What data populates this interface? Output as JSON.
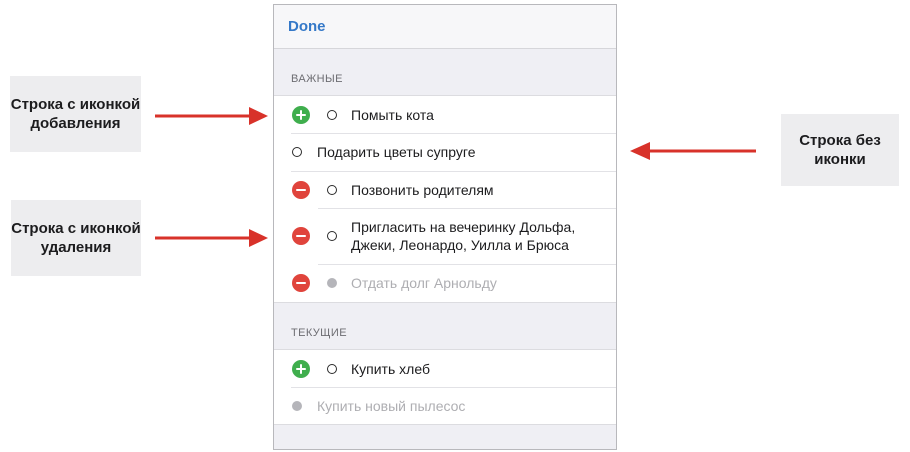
{
  "nav": {
    "done_label": "Done"
  },
  "sections": [
    {
      "header": "ВАЖНЫЕ",
      "rows": [
        {
          "control": "add",
          "status": "open",
          "text": "Помыть кота"
        },
        {
          "control": "none",
          "status": "open",
          "text": "Подарить цветы супруге"
        },
        {
          "control": "remove",
          "status": "open",
          "text": "Позвонить родителям"
        },
        {
          "control": "remove",
          "status": "open",
          "text": "Пригласить на вечеринку Дольфа, Джеки, Леонардо, Уилла и Брюса"
        },
        {
          "control": "remove",
          "status": "done",
          "text": "Отдать долг Арнольду"
        }
      ]
    },
    {
      "header": "ТЕКУЩИЕ",
      "rows": [
        {
          "control": "add",
          "status": "open",
          "text": "Купить хлеб"
        },
        {
          "control": "none",
          "status": "done",
          "text": "Купить новый пылесос"
        }
      ]
    }
  ],
  "callouts": {
    "add_row": "Строка с иконкой добавления",
    "remove_row": "Строка с иконкой удаления",
    "plain_row": "Строка без иконки"
  },
  "colors": {
    "add": "#3fae4d",
    "remove": "#e0443c",
    "link": "#3478c8",
    "arrow": "#d8322a",
    "callout_bg": "#ededef"
  },
  "icons": {
    "add": "plus-circle-icon",
    "remove": "minus-circle-icon",
    "open": "empty-circle-icon",
    "done": "filled-circle-icon",
    "arrow": "arrow-icon"
  }
}
